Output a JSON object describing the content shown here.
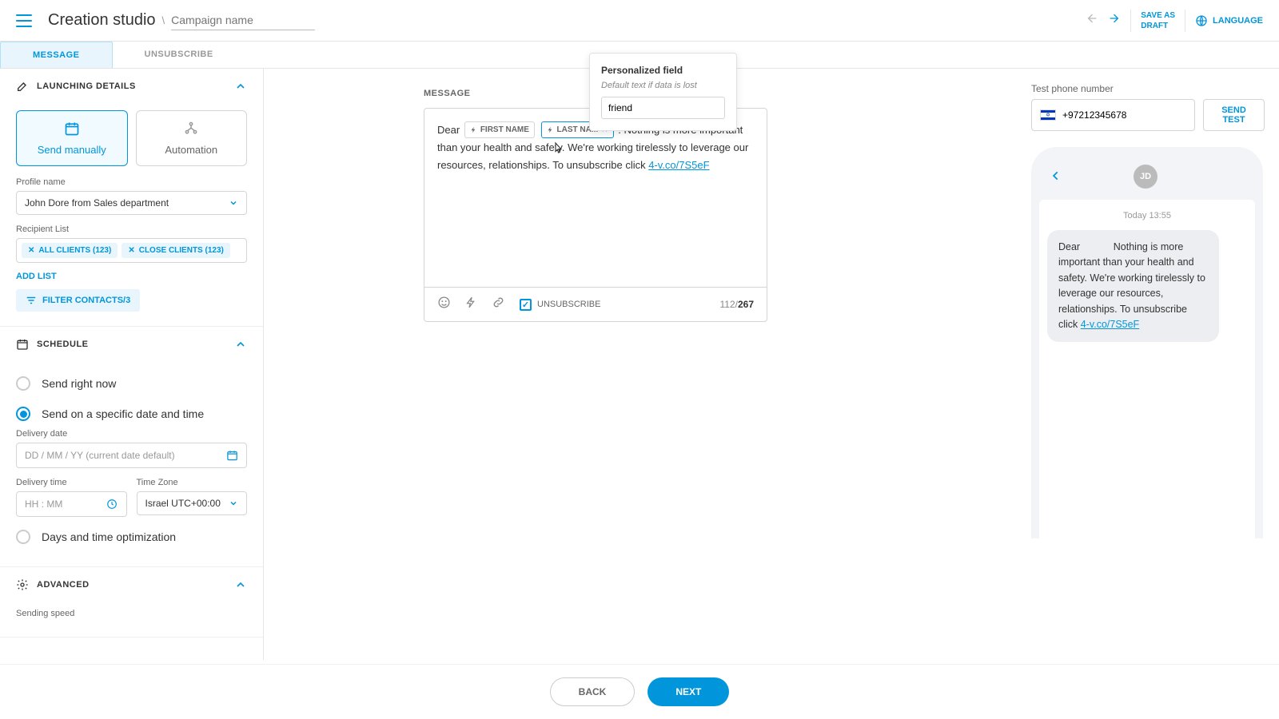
{
  "header": {
    "title": "Creation studio",
    "campaign_placeholder": "Campaign name",
    "save_draft": "SAVE AS\nDRAFT",
    "language": "LANGUAGE"
  },
  "tabs": {
    "message": "MESSAGE",
    "unsubscribe": "UNSUBSCRIBE"
  },
  "launching": {
    "title": "LAUNCHING DETAILS",
    "send_manually": "Send manually",
    "automation": "Automation",
    "profile_label": "Profile name",
    "profile_value": "John Dore from Sales department",
    "recipient_label": "Recipient List",
    "chips": [
      "ALL CLIENTS (123)",
      "CLOSE CLIENTS (123)"
    ],
    "add_list": "ADD LIST",
    "filter": "FILTER CONTACTS/3"
  },
  "schedule": {
    "title": "SCHEDULE",
    "now": "Send right now",
    "specific": "Send on a specific date and time",
    "delivery_date_label": "Delivery date",
    "delivery_date_placeholder": "DD / MM / YY (current date default)",
    "delivery_time_label": "Delivery time",
    "delivery_time_placeholder": "HH : MM",
    "tz_label": "Time Zone",
    "tz_value": "Israel UTC+00:00",
    "optimize": "Days and time optimization"
  },
  "advanced": {
    "title": "ADVANCED",
    "sending_speed": "Sending speed"
  },
  "editor": {
    "label": "MESSAGE",
    "prefix": "Dear",
    "token1": "FIRST NAME",
    "token2": "LAST NAM",
    "body": ". Nothing is more important than your health and safety. We're working tirelessly to leverage our resources, relationships. To unsubscribe click ",
    "link": "4-v.co/7S5eF",
    "unsub": "UNSUBSCRIBE",
    "count_current": "112",
    "count_sep": "/",
    "count_max": "267"
  },
  "popover": {
    "title": "Personalized field",
    "subtitle": "Default text if data is lost",
    "value": "friend"
  },
  "preview": {
    "label": "Test phone number",
    "phone": "+97212345678",
    "send_test": "SEND TEST",
    "avatar": "JD",
    "timestamp": "Today 13:55",
    "bubble_1": "Dear",
    "bubble_2": "Nothing is more important than your health and safety. We're working tirelessly to leverage our resources, relationships. To unsubscribe click ",
    "bubble_link": "4-v.co/7S5eF"
  },
  "footer": {
    "back": "BACK",
    "next": "NEXT"
  }
}
